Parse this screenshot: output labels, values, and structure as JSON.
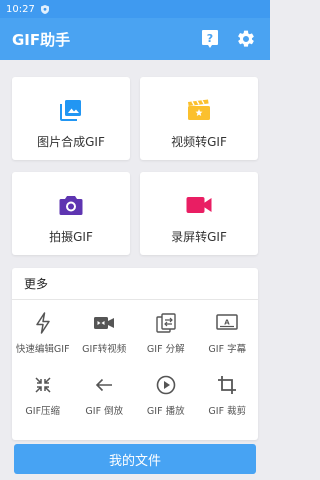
{
  "status_bar": {
    "time": "10:27"
  },
  "app_bar": {
    "title": "GIF助手",
    "help_icon": "help-icon",
    "settings_icon": "gear-icon"
  },
  "cards": [
    {
      "label": "图片合成GIF",
      "icon": "image-stack-icon",
      "color": "#2196f3"
    },
    {
      "label": "视频转GIF",
      "icon": "clapperboard-icon",
      "color": "#fbc02d"
    },
    {
      "label": "拍摄GIF",
      "icon": "camera-icon",
      "color": "#5e35b1"
    },
    {
      "label": "录屏转GIF",
      "icon": "video-camera-icon",
      "color": "#e91e63"
    }
  ],
  "more": {
    "title": "更多",
    "tools": [
      {
        "label": "快速编辑GIF",
        "icon": "flash-icon"
      },
      {
        "label": "GIF转视频",
        "icon": "video-convert-icon"
      },
      {
        "label": "GIF 分解",
        "icon": "split-icon"
      },
      {
        "label": "GIF 字幕",
        "icon": "subtitle-icon"
      },
      {
        "label": "GIF压缩",
        "icon": "compress-icon"
      },
      {
        "label": "GIF 倒放",
        "icon": "arrow-left-icon"
      },
      {
        "label": "GIF 播放",
        "icon": "play-circle-icon"
      },
      {
        "label": "GIF 裁剪",
        "icon": "crop-icon"
      }
    ]
  },
  "bottom_button": {
    "label": "我的文件"
  }
}
